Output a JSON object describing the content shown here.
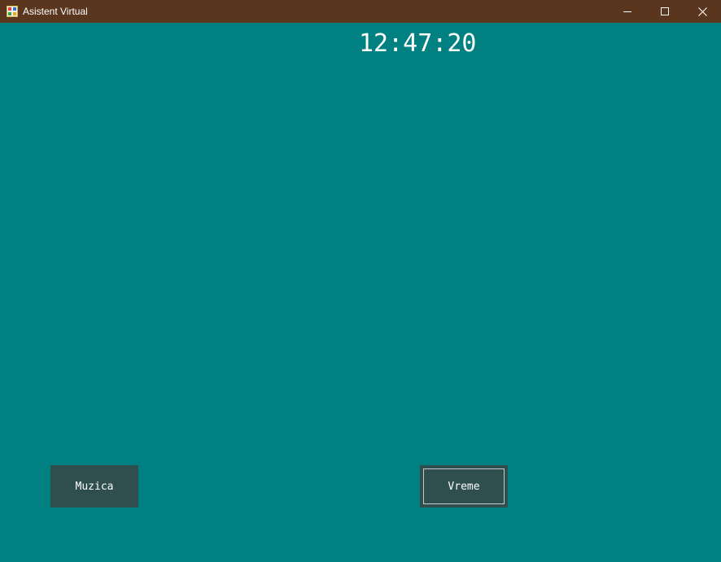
{
  "window": {
    "title": "Asistent Virtual",
    "icon": "app-icon",
    "controls": {
      "minimize_icon": "minimize-icon",
      "maximize_icon": "maximize-icon",
      "close_icon": "close-icon"
    },
    "titlebar_color": "#5a361e",
    "background_color": "#008080"
  },
  "clock": {
    "time": "12:47:20"
  },
  "buttons": {
    "muzica_label": "Muzica",
    "vreme_label": "Vreme",
    "button_color": "#2f4f4f",
    "focused": "Vreme"
  }
}
